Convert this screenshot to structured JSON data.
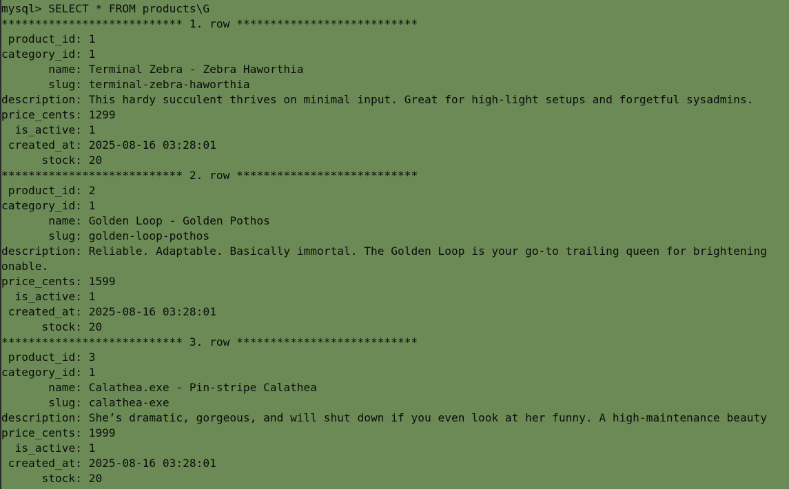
{
  "terminal": {
    "lines": [
      "mysql> SELECT * FROM products\\G",
      "*************************** 1. row ***************************",
      " product_id: 1",
      "category_id: 1",
      "       name: Terminal Zebra - Zebra Haworthia",
      "       slug: terminal-zebra-haworthia",
      "description: This hardy succulent thrives on minimal input. Great for high-light setups and forgetful sysadmins.",
      "price_cents: 1299",
      "  is_active: 1",
      " created_at: 2025-08-16 03:28:01",
      "      stock: 20",
      "*************************** 2. row ***************************",
      " product_id: 2",
      "category_id: 1",
      "       name: Golden Loop - Golden Pothos",
      "       slug: golden-loop-pothos",
      "description: Reliable. Adaptable. Basically immortal. The Golden Loop is your go-to trailing queen for brightening",
      "onable.",
      "price_cents: 1599",
      "  is_active: 1",
      " created_at: 2025-08-16 03:28:01",
      "      stock: 20",
      "*************************** 3. row ***************************",
      " product_id: 3",
      "category_id: 1",
      "       name: Calathea.exe - Pin-stripe Calathea",
      "       slug: calathea-exe",
      "description: She’s dramatic, gorgeous, and will shut down if you even look at her funny. A high-maintenance beauty",
      "price_cents: 1999",
      "  is_active: 1",
      " created_at: 2025-08-16 03:28:01",
      "      stock: 20"
    ]
  }
}
